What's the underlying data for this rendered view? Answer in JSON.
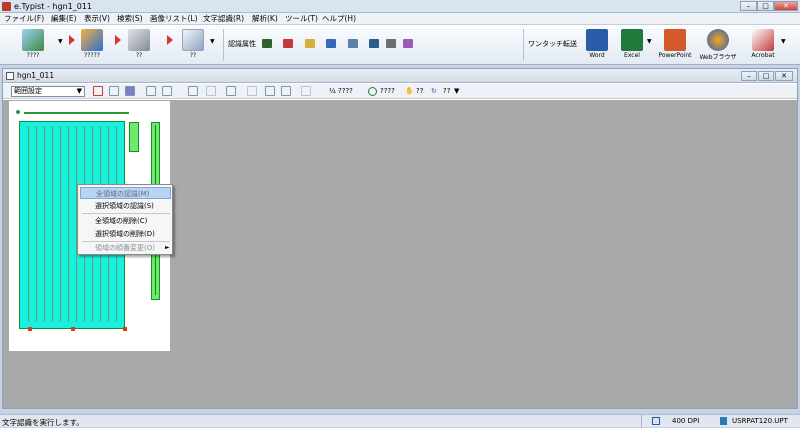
{
  "window": {
    "title": "e.Typist - hgn1_011",
    "min": "–",
    "max": "□",
    "close": "✕"
  },
  "menu": [
    "ファイル(F)",
    "編集(E)",
    "表示(V)",
    "検索(S)",
    "画像リスト(L)",
    "文字認識(R)",
    "解析(K)",
    "ツール(T)",
    "ヘルプ(H)"
  ],
  "ribbon": {
    "btn1": "????",
    "btn2": "?????",
    "btn3": "??",
    "attr_label": "認識属性",
    "onetouch": "ワンタッチ転送",
    "word": "Word",
    "excel": "Excel",
    "ppt": "PowerPoint",
    "web": "Webブラウザ",
    "acrobat": "Acrobat"
  },
  "doc": {
    "title": "hgn1_011",
    "range_select": "範囲設定",
    "tb_frac": "¼ ????",
    "tb_zoom": "????",
    "tb_q1": "??",
    "tb_q2": "??"
  },
  "context_menu": [
    {
      "label": "全領域の認識(M)",
      "state": "selected"
    },
    {
      "label": "選択領域の認識(S)",
      "state": "normal"
    },
    {
      "label": "全領域の削除(C)",
      "state": "normal"
    },
    {
      "label": "選択領域の削除(D)",
      "state": "normal"
    },
    {
      "label": "領域の順番変更(O)",
      "state": "disabled",
      "submenu": true
    }
  ],
  "status": {
    "message": "文字認識を実行します。",
    "dpi": "400 DPI",
    "file": "USRPAT120.UPT"
  },
  "colors": {
    "region_fill": "#18f0e0",
    "region_border": "#1a8f2a",
    "canvas": "#a9a9a9",
    "accent_red": "#d43a2a"
  }
}
